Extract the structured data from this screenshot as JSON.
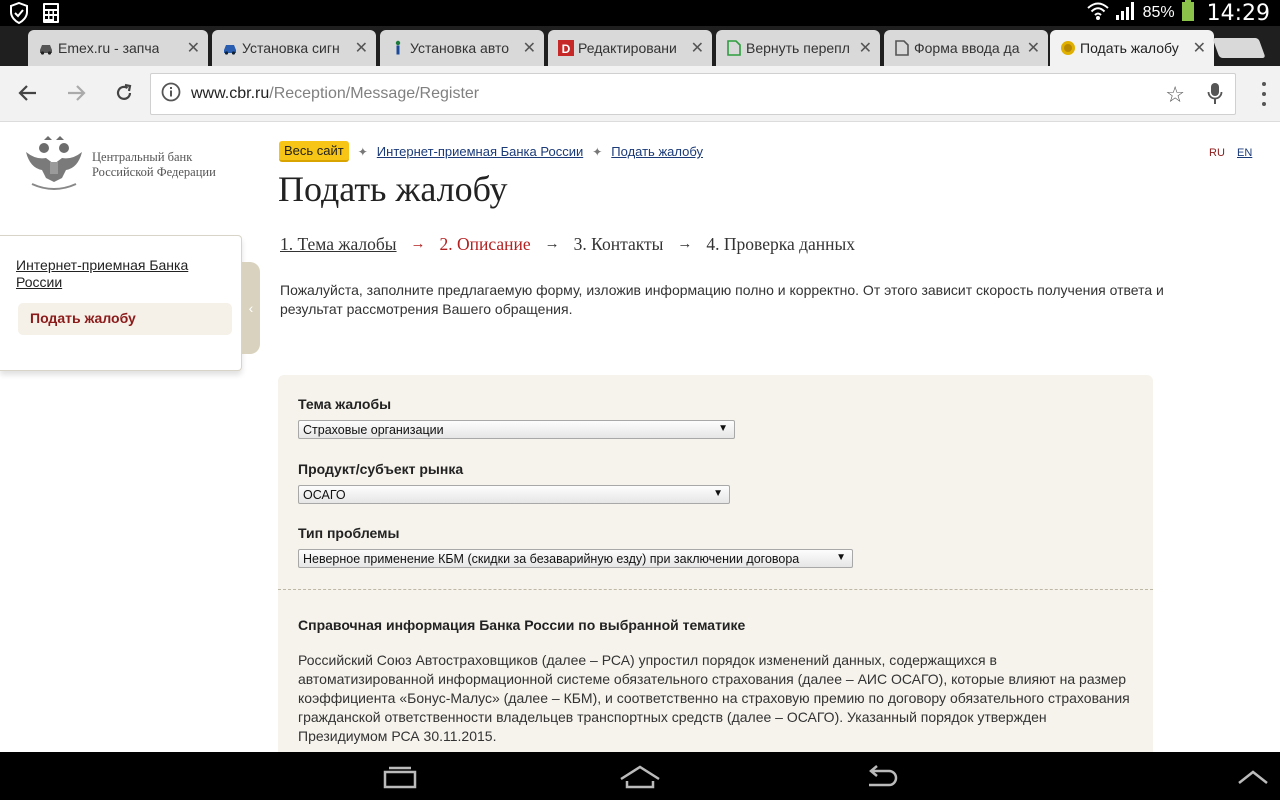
{
  "status_bar": {
    "battery": "85%",
    "time": "14:29"
  },
  "tabs": [
    {
      "title": "Emex.ru - запча"
    },
    {
      "title": "Установка сигн"
    },
    {
      "title": "Установка авто"
    },
    {
      "title": "Редактировани"
    },
    {
      "title": "Вернуть перепл"
    },
    {
      "title": "Форма ввода да"
    },
    {
      "title": "Подать жалобу"
    }
  ],
  "omnibox": {
    "domain": "www.cbr.ru",
    "path": "/Reception/Message/Register"
  },
  "logo": {
    "line1": "Центральный банк",
    "line2": "Российской Федерации"
  },
  "sidebar": {
    "link": "Интернет-приемная Банка России",
    "active": "Подать жалобу"
  },
  "breadcrumb": {
    "all_site": "Весь сайт",
    "item1": "Интернет-приемная Банка России",
    "item2": "Подать жалобу"
  },
  "lang": {
    "ru": "RU",
    "en": "EN"
  },
  "page_title": "Подать жалобу",
  "steps": [
    "1. Тема жалобы",
    "2. Описание",
    "3. Контакты",
    "4. Проверка данных"
  ],
  "intro": "Пожалуйста, заполните предлагаемую форму, изложив информацию полно и корректно. От этого зависит скорость получения ответа и результат рассмотрения Вашего обращения.",
  "form": {
    "topic_label": "Тема жалобы",
    "topic_value": "Страховые организации",
    "product_label": "Продукт/субъект рынка",
    "product_value": "ОСАГО",
    "problem_label": "Тип проблемы",
    "problem_value": "Неверное применение КБМ (скидки за безаварийную езду) при заключении договора",
    "info_title": "Справочная информация Банка России по выбранной тематике",
    "info_text": "Российский Союз Автостраховщиков (далее – РСА) упростил порядок изменений данных, содержащихся в автоматизированной информационной системе обязательного страхования (далее – АИС ОСАГО), которые влияют на размер коэффициента «Бонус-Малус» (далее – КБМ), и соответственно на страховую премию по договору обязательного страхования гражданской ответственности владельцев транспортных средств (далее – ОСАГО). Указанный порядок утвержден Президиумом РСА 30.11.2015."
  }
}
